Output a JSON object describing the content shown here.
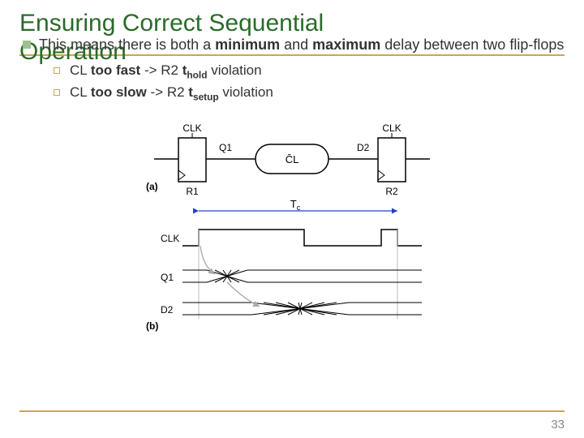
{
  "title_line1": "Ensuring Correct Sequential",
  "title_line2": "Operation",
  "main_bullet": {
    "prefix": "This means there is both a ",
    "min": "minimum",
    "mid": " and ",
    "max": "maximum",
    "suffix": " delay between two flip-flops"
  },
  "sub_bullets": [
    {
      "pre": "CL ",
      "bold1": "too fast",
      "mid": " -> R2 ",
      "bold2": "t",
      "sub2": "hold",
      "tail": " violation"
    },
    {
      "pre": "CL ",
      "bold1": "too slow",
      "mid": " -> R2 ",
      "bold2": "t",
      "sub2": "setup",
      "tail": " violation"
    }
  ],
  "diagram": {
    "clk_top_left": "CLK",
    "clk_top_right": "CLK",
    "q1": "Q1",
    "cl": "CL",
    "d2": "D2",
    "r1": "R1",
    "r2": "R2",
    "label_a": "(a)",
    "tc": "T",
    "tc_sub": "c",
    "clk_row": "CLK",
    "q1_row": "Q1",
    "d2_row": "D2",
    "label_b": "(b)"
  },
  "page_number": "33"
}
